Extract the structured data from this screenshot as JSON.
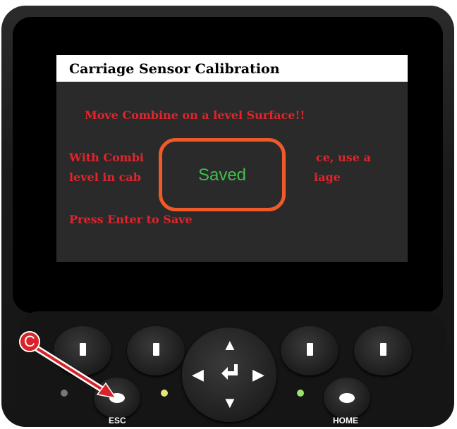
{
  "screen": {
    "title": "Carriage Sensor Calibration",
    "line1": "Move Combine on a level Surface!!",
    "line2": "With Combi",
    "line2_right": "ce, use a",
    "line3": "level in cab",
    "line3_right": "iage",
    "line4": "Press Enter to Save"
  },
  "popup": {
    "text": "Saved",
    "border_color": "#f05a28",
    "text_color": "#3fbf4a"
  },
  "buttons": {
    "esc_label": "ESC",
    "home_label": "HOME"
  },
  "callout": {
    "label": "C",
    "color": "#d8232a"
  },
  "colors": {
    "message_red": "#e3242b",
    "led_left": "#777777",
    "led_middle": "#e8e27a",
    "led_right": "#9be36a"
  },
  "icons": [
    "up-arrow-icon",
    "down-arrow-icon",
    "left-arrow-icon",
    "right-arrow-icon",
    "enter-icon"
  ]
}
